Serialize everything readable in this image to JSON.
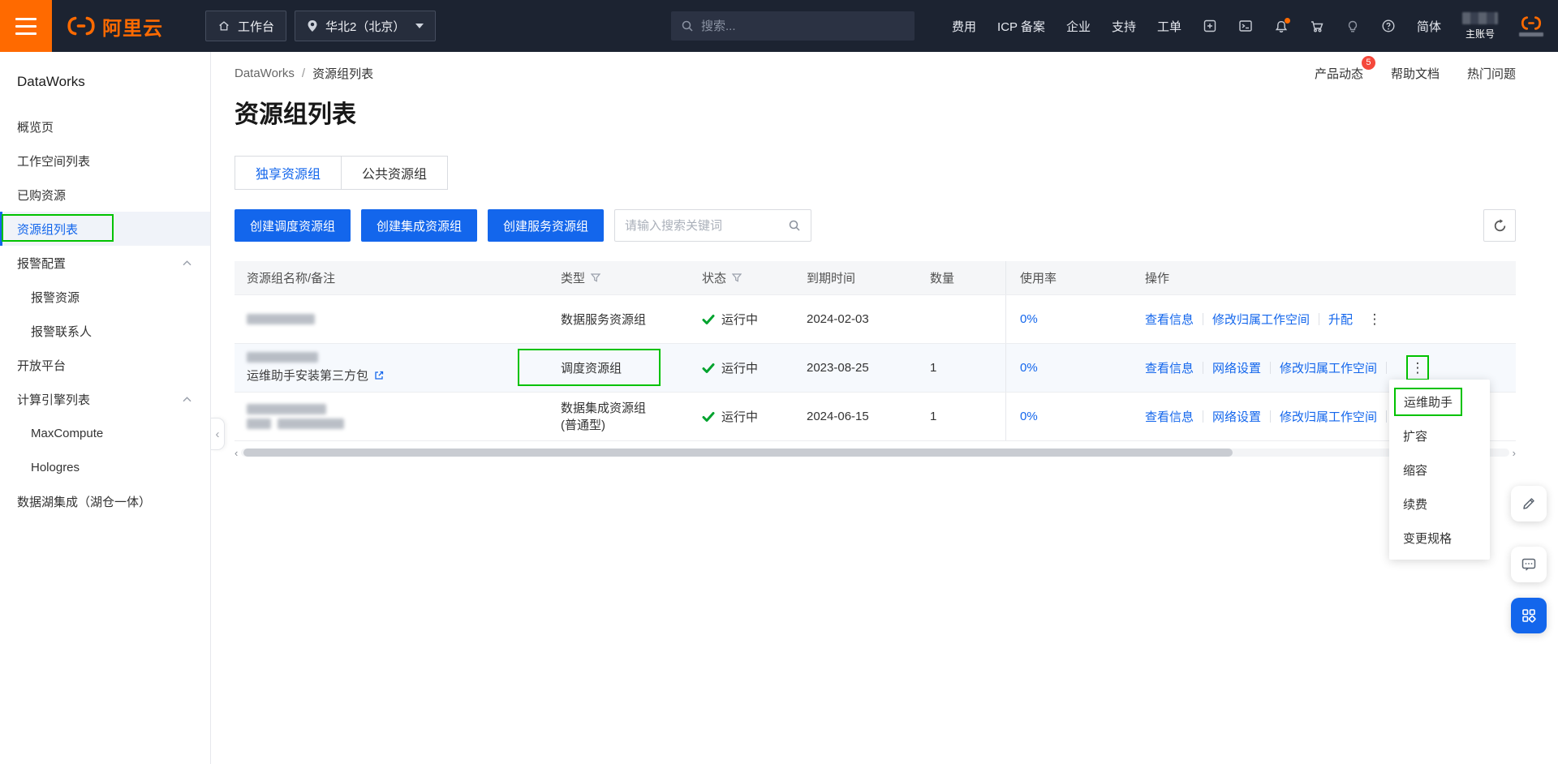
{
  "colors": {
    "accent_orange": "#ff6a00",
    "primary_blue": "#1366ec",
    "annotation_green": "#00c200",
    "success_green": "#00a32e"
  },
  "header": {
    "brand": "阿里云",
    "workbench_label": "工作台",
    "region_label": "华北2（北京）",
    "search_placeholder": "搜索...",
    "nav_items": [
      "费用",
      "ICP 备案",
      "企业",
      "支持",
      "工单"
    ],
    "icons": [
      "app-icon",
      "terminal-icon",
      "bell-icon",
      "cart-icon",
      "bulb-icon",
      "help-icon"
    ],
    "lang_label": "简体",
    "account_label": "主账号"
  },
  "sidebar": {
    "title": "DataWorks",
    "items": [
      {
        "label": "概览页"
      },
      {
        "label": "工作空间列表"
      },
      {
        "label": "已购资源"
      },
      {
        "label": "资源组列表"
      },
      {
        "label": "报警配置"
      },
      {
        "label": "报警资源"
      },
      {
        "label": "报警联系人"
      },
      {
        "label": "开放平台"
      },
      {
        "label": "计算引擎列表"
      },
      {
        "label": "MaxCompute"
      },
      {
        "label": "Hologres"
      },
      {
        "label": "数据湖集成（湖仓一体）"
      }
    ]
  },
  "breadcrumb": {
    "root": "DataWorks",
    "separator": "/",
    "current": "资源组列表"
  },
  "quicklinks": {
    "product_news": "产品动态",
    "product_news_badge": "5",
    "help_docs": "帮助文档",
    "hot_issues": "热门问题"
  },
  "page": {
    "title": "资源组列表"
  },
  "tabs": [
    {
      "label": "独享资源组"
    },
    {
      "label": "公共资源组"
    }
  ],
  "toolbar": {
    "create_scheduler": "创建调度资源组",
    "create_integration": "创建集成资源组",
    "create_service": "创建服务资源组",
    "search_placeholder": "请输入搜索关键词"
  },
  "table": {
    "columns": [
      "资源组名称/备注",
      "类型",
      "状态",
      "到期时间",
      "数量",
      "使用率",
      "操作"
    ],
    "rows": [
      {
        "type": "数据服务资源组",
        "status": "运行中",
        "expire": "2024-02-03",
        "count": "",
        "usage": "0%",
        "actions": [
          "查看信息",
          "修改归属工作空间",
          "升配"
        ]
      },
      {
        "note": "运维助手安装第三方包",
        "type": "调度资源组",
        "status": "运行中",
        "expire": "2023-08-25",
        "count": "1",
        "usage": "0%",
        "actions": [
          "查看信息",
          "网络设置",
          "修改归属工作空间"
        ]
      },
      {
        "type": "数据集成资源组",
        "type2": "(普通型)",
        "status": "运行中",
        "expire": "2024-06-15",
        "count": "1",
        "usage": "0%",
        "actions": [
          "查看信息",
          "网络设置",
          "修改归属工作空间"
        ]
      }
    ]
  },
  "context_menu": {
    "items": [
      "运维助手",
      "扩容",
      "缩容",
      "续费",
      "变更规格"
    ]
  }
}
